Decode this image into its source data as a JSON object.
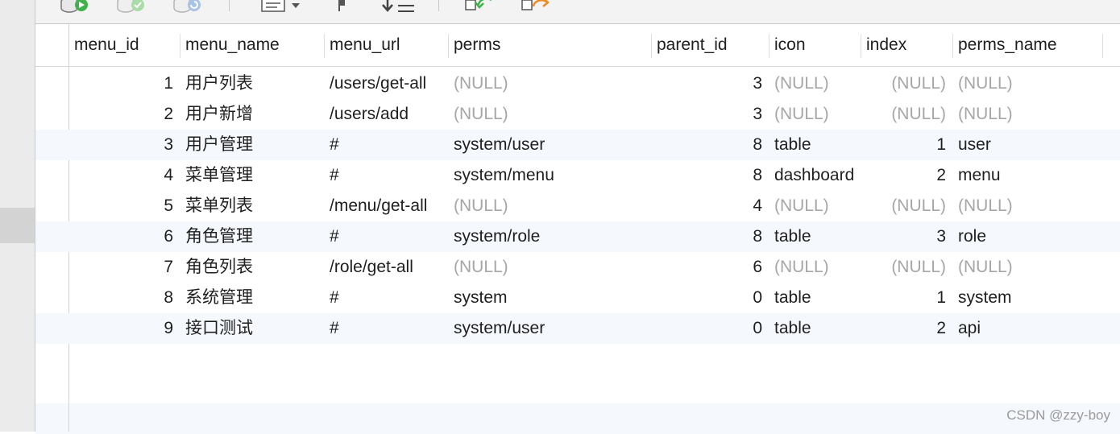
{
  "toolbar": {
    "icons": [
      "db-run-icon",
      "db-check-icon",
      "db-refresh-icon",
      "text-view-icon",
      "flag-icon",
      "sort-icon",
      "import-icon",
      "export-icon"
    ]
  },
  "columns": [
    "menu_id",
    "menu_name",
    "menu_url",
    "perms",
    "parent_id",
    "icon",
    "index",
    "perms_name"
  ],
  "rows": [
    {
      "menu_id": "1",
      "menu_name": "用户列表",
      "menu_url": "/users/get-all",
      "perms": "(NULL)",
      "parent_id": "3",
      "icon": "(NULL)",
      "index": "(NULL)",
      "perms_name": "(NULL)"
    },
    {
      "menu_id": "2",
      "menu_name": "用户新增",
      "menu_url": "/users/add",
      "perms": "(NULL)",
      "parent_id": "3",
      "icon": "(NULL)",
      "index": "(NULL)",
      "perms_name": "(NULL)"
    },
    {
      "menu_id": "3",
      "menu_name": "用户管理",
      "menu_url": "#",
      "perms": "system/user",
      "parent_id": "8",
      "icon": "table",
      "index": "1",
      "perms_name": "user"
    },
    {
      "menu_id": "4",
      "menu_name": "菜单管理",
      "menu_url": "#",
      "perms": "system/menu",
      "parent_id": "8",
      "icon": "dashboard",
      "index": "2",
      "perms_name": "menu"
    },
    {
      "menu_id": "5",
      "menu_name": "菜单列表",
      "menu_url": "/menu/get-all",
      "perms": "(NULL)",
      "parent_id": "4",
      "icon": "(NULL)",
      "index": "(NULL)",
      "perms_name": "(NULL)"
    },
    {
      "menu_id": "6",
      "menu_name": "角色管理",
      "menu_url": "#",
      "perms": "system/role",
      "parent_id": "8",
      "icon": "table",
      "index": "3",
      "perms_name": "role"
    },
    {
      "menu_id": "7",
      "menu_name": "角色列表",
      "menu_url": "/role/get-all",
      "perms": "(NULL)",
      "parent_id": "6",
      "icon": "(NULL)",
      "index": "(NULL)",
      "perms_name": "(NULL)"
    },
    {
      "menu_id": "8",
      "menu_name": "系统管理",
      "menu_url": "#",
      "perms": "system",
      "parent_id": "0",
      "icon": "table",
      "index": "1",
      "perms_name": "system"
    },
    {
      "menu_id": "9",
      "menu_name": "接口测试",
      "menu_url": "#",
      "perms": "system/user",
      "parent_id": "0",
      "icon": "table",
      "index": "2",
      "perms_name": "api"
    }
  ],
  "watermark": "CSDN @zzy-boy",
  "colors": {
    "null_text": "#a6a6a6",
    "alt_row": "#f5f8fc",
    "run_green": "#3fb24a",
    "orange": "#f08a24"
  }
}
